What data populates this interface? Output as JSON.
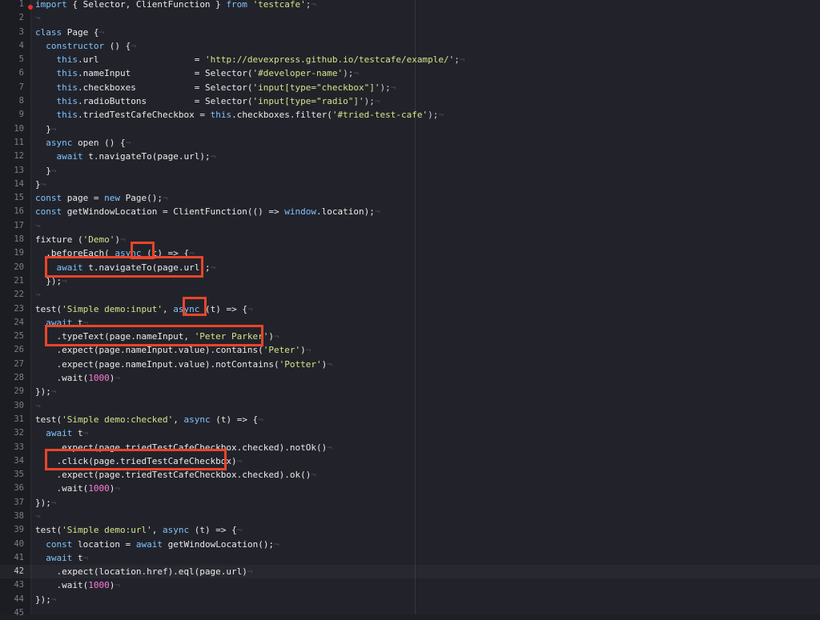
{
  "editor": {
    "current_line": 42,
    "breakpoint_line": 1,
    "lines": [
      {
        "n": "1",
        "tokens": [
          {
            "t": "import",
            "c": "kw"
          },
          {
            "t": " { Selector, ClientFunction } ",
            "c": "plain"
          },
          {
            "t": "from",
            "c": "kw"
          },
          {
            "t": " ",
            "c": "plain"
          },
          {
            "t": "'testcafe'",
            "c": "str"
          },
          {
            "t": ";",
            "c": "pn"
          },
          {
            "t": "¬",
            "c": "ws"
          }
        ]
      },
      {
        "n": "2",
        "tokens": [
          {
            "t": "¬",
            "c": "ws"
          }
        ]
      },
      {
        "n": "3",
        "tokens": [
          {
            "t": "class",
            "c": "kw"
          },
          {
            "t": " Page {",
            "c": "plain"
          },
          {
            "t": "¬",
            "c": "ws"
          }
        ]
      },
      {
        "n": "4",
        "tokens": [
          {
            "t": "  ",
            "c": "plain"
          },
          {
            "t": "constructor",
            "c": "kw"
          },
          {
            "t": " () {",
            "c": "plain"
          },
          {
            "t": "¬",
            "c": "ws"
          }
        ]
      },
      {
        "n": "5",
        "tokens": [
          {
            "t": "    ",
            "c": "plain"
          },
          {
            "t": "this",
            "c": "kw"
          },
          {
            "t": ".url                  = ",
            "c": "plain"
          },
          {
            "t": "'http://devexpress.github.io/testcafe/example/'",
            "c": "str"
          },
          {
            "t": ";",
            "c": "pn"
          },
          {
            "t": "¬",
            "c": "ws"
          }
        ]
      },
      {
        "n": "6",
        "tokens": [
          {
            "t": "    ",
            "c": "plain"
          },
          {
            "t": "this",
            "c": "kw"
          },
          {
            "t": ".nameInput            = Selector(",
            "c": "plain"
          },
          {
            "t": "'#developer-name'",
            "c": "str"
          },
          {
            "t": ");",
            "c": "pn"
          },
          {
            "t": "¬",
            "c": "ws"
          }
        ]
      },
      {
        "n": "7",
        "tokens": [
          {
            "t": "    ",
            "c": "plain"
          },
          {
            "t": "this",
            "c": "kw"
          },
          {
            "t": ".checkboxes           = Selector(",
            "c": "plain"
          },
          {
            "t": "'input[type=\"checkbox\"]'",
            "c": "str"
          },
          {
            "t": ");",
            "c": "pn"
          },
          {
            "t": "¬",
            "c": "ws"
          }
        ]
      },
      {
        "n": "8",
        "tokens": [
          {
            "t": "    ",
            "c": "plain"
          },
          {
            "t": "this",
            "c": "kw"
          },
          {
            "t": ".radioButtons         = Selector(",
            "c": "plain"
          },
          {
            "t": "'input[type=\"radio\"]'",
            "c": "str"
          },
          {
            "t": ");",
            "c": "pn"
          },
          {
            "t": "¬",
            "c": "ws"
          }
        ]
      },
      {
        "n": "9",
        "tokens": [
          {
            "t": "    ",
            "c": "plain"
          },
          {
            "t": "this",
            "c": "kw"
          },
          {
            "t": ".triedTestCafeCheckbox = ",
            "c": "plain"
          },
          {
            "t": "this",
            "c": "kw"
          },
          {
            "t": ".checkboxes.filter(",
            "c": "plain"
          },
          {
            "t": "'#tried-test-cafe'",
            "c": "str"
          },
          {
            "t": ");",
            "c": "pn"
          },
          {
            "t": "¬",
            "c": "ws"
          }
        ]
      },
      {
        "n": "10",
        "tokens": [
          {
            "t": "  }",
            "c": "plain"
          },
          {
            "t": "¬",
            "c": "ws"
          }
        ]
      },
      {
        "n": "11",
        "tokens": [
          {
            "t": "  ",
            "c": "plain"
          },
          {
            "t": "async",
            "c": "kw"
          },
          {
            "t": " open () {",
            "c": "plain"
          },
          {
            "t": "¬",
            "c": "ws"
          }
        ]
      },
      {
        "n": "12",
        "tokens": [
          {
            "t": "    ",
            "c": "plain"
          },
          {
            "t": "await",
            "c": "kw"
          },
          {
            "t": " t.navigateTo(page.url);",
            "c": "plain"
          },
          {
            "t": "¬",
            "c": "ws"
          }
        ]
      },
      {
        "n": "13",
        "tokens": [
          {
            "t": "  }",
            "c": "plain"
          },
          {
            "t": "¬",
            "c": "ws"
          }
        ]
      },
      {
        "n": "14",
        "tokens": [
          {
            "t": "}",
            "c": "plain"
          },
          {
            "t": "¬",
            "c": "ws"
          }
        ]
      },
      {
        "n": "15",
        "tokens": [
          {
            "t": "const",
            "c": "kw"
          },
          {
            "t": " page = ",
            "c": "plain"
          },
          {
            "t": "new",
            "c": "kw"
          },
          {
            "t": " Page();",
            "c": "plain"
          },
          {
            "t": "¬",
            "c": "ws"
          }
        ]
      },
      {
        "n": "16",
        "tokens": [
          {
            "t": "const",
            "c": "kw"
          },
          {
            "t": " getWindowLocation = ClientFunction(() => ",
            "c": "plain"
          },
          {
            "t": "window",
            "c": "kw"
          },
          {
            "t": ".location);",
            "c": "plain"
          },
          {
            "t": "¬",
            "c": "ws"
          }
        ]
      },
      {
        "n": "17",
        "tokens": [
          {
            "t": "¬",
            "c": "ws"
          }
        ]
      },
      {
        "n": "18",
        "tokens": [
          {
            "t": "fixture",
            "c": "plain"
          },
          {
            "t": " (",
            "c": "plain"
          },
          {
            "t": "'Demo'",
            "c": "str"
          },
          {
            "t": ")",
            "c": "plain"
          },
          {
            "t": "¬",
            "c": "ws"
          }
        ]
      },
      {
        "n": "19",
        "tokens": [
          {
            "t": "  .beforeEach( ",
            "c": "plain"
          },
          {
            "t": "async",
            "c": "kw"
          },
          {
            "t": " (t) => {",
            "c": "plain"
          },
          {
            "t": "¬",
            "c": "ws"
          }
        ]
      },
      {
        "n": "20",
        "tokens": [
          {
            "t": "    ",
            "c": "plain"
          },
          {
            "t": "await",
            "c": "kw"
          },
          {
            "t": " t.navigateTo(page.url);",
            "c": "plain"
          },
          {
            "t": "¬",
            "c": "ws"
          }
        ]
      },
      {
        "n": "21",
        "tokens": [
          {
            "t": "  });",
            "c": "plain"
          },
          {
            "t": "¬",
            "c": "ws"
          }
        ]
      },
      {
        "n": "22",
        "tokens": [
          {
            "t": "¬",
            "c": "ws"
          }
        ]
      },
      {
        "n": "23",
        "tokens": [
          {
            "t": "test(",
            "c": "plain"
          },
          {
            "t": "'Simple demo:input'",
            "c": "str"
          },
          {
            "t": ", ",
            "c": "plain"
          },
          {
            "t": "async",
            "c": "kw"
          },
          {
            "t": " (t) => {",
            "c": "plain"
          },
          {
            "t": "¬",
            "c": "ws"
          }
        ]
      },
      {
        "n": "24",
        "tokens": [
          {
            "t": "  ",
            "c": "plain"
          },
          {
            "t": "await",
            "c": "kw"
          },
          {
            "t": " t",
            "c": "plain"
          },
          {
            "t": "¬",
            "c": "ws"
          }
        ]
      },
      {
        "n": "25",
        "tokens": [
          {
            "t": "    .typeText(page.nameInput, ",
            "c": "plain"
          },
          {
            "t": "'Peter Parker'",
            "c": "str"
          },
          {
            "t": ")",
            "c": "plain"
          },
          {
            "t": "¬",
            "c": "ws"
          }
        ]
      },
      {
        "n": "26",
        "tokens": [
          {
            "t": "    .expect(page.nameInput.value).contains(",
            "c": "plain"
          },
          {
            "t": "'Peter'",
            "c": "str"
          },
          {
            "t": ")",
            "c": "plain"
          },
          {
            "t": "¬",
            "c": "ws"
          }
        ]
      },
      {
        "n": "27",
        "tokens": [
          {
            "t": "    .expect(page.nameInput.value).notContains(",
            "c": "plain"
          },
          {
            "t": "'Potter'",
            "c": "str"
          },
          {
            "t": ")",
            "c": "plain"
          },
          {
            "t": "¬",
            "c": "ws"
          }
        ]
      },
      {
        "n": "28",
        "tokens": [
          {
            "t": "    .wait(",
            "c": "plain"
          },
          {
            "t": "1000",
            "c": "num"
          },
          {
            "t": ")",
            "c": "plain"
          },
          {
            "t": "¬",
            "c": "ws"
          }
        ]
      },
      {
        "n": "29",
        "tokens": [
          {
            "t": "});",
            "c": "plain"
          },
          {
            "t": "¬",
            "c": "ws"
          }
        ]
      },
      {
        "n": "30",
        "tokens": [
          {
            "t": "¬",
            "c": "ws"
          }
        ]
      },
      {
        "n": "31",
        "tokens": [
          {
            "t": "test(",
            "c": "plain"
          },
          {
            "t": "'Simple demo:checked'",
            "c": "str"
          },
          {
            "t": ", ",
            "c": "plain"
          },
          {
            "t": "async",
            "c": "kw"
          },
          {
            "t": " (t) => {",
            "c": "plain"
          },
          {
            "t": "¬",
            "c": "ws"
          }
        ]
      },
      {
        "n": "32",
        "tokens": [
          {
            "t": "  ",
            "c": "plain"
          },
          {
            "t": "await",
            "c": "kw"
          },
          {
            "t": " t",
            "c": "plain"
          },
          {
            "t": "¬",
            "c": "ws"
          }
        ]
      },
      {
        "n": "33",
        "tokens": [
          {
            "t": "    .expect(page.triedTestCafeCheckbox.checked).notOk()",
            "c": "plain"
          },
          {
            "t": "¬",
            "c": "ws"
          }
        ]
      },
      {
        "n": "34",
        "tokens": [
          {
            "t": "    .click(page.triedTestCafeCheckbox)",
            "c": "plain"
          },
          {
            "t": "¬",
            "c": "ws"
          }
        ]
      },
      {
        "n": "35",
        "tokens": [
          {
            "t": "    .expect(page.triedTestCafeCheckbox.checked).ok()",
            "c": "plain"
          },
          {
            "t": "¬",
            "c": "ws"
          }
        ]
      },
      {
        "n": "36",
        "tokens": [
          {
            "t": "    .wait(",
            "c": "plain"
          },
          {
            "t": "1000",
            "c": "num"
          },
          {
            "t": ")",
            "c": "plain"
          },
          {
            "t": "¬",
            "c": "ws"
          }
        ]
      },
      {
        "n": "37",
        "tokens": [
          {
            "t": "});",
            "c": "plain"
          },
          {
            "t": "¬",
            "c": "ws"
          }
        ]
      },
      {
        "n": "38",
        "tokens": [
          {
            "t": "¬",
            "c": "ws"
          }
        ]
      },
      {
        "n": "39",
        "tokens": [
          {
            "t": "test(",
            "c": "plain"
          },
          {
            "t": "'Simple demo:url'",
            "c": "str"
          },
          {
            "t": ", ",
            "c": "plain"
          },
          {
            "t": "async",
            "c": "kw"
          },
          {
            "t": " (t) => {",
            "c": "plain"
          },
          {
            "t": "¬",
            "c": "ws"
          }
        ]
      },
      {
        "n": "40",
        "tokens": [
          {
            "t": "  ",
            "c": "plain"
          },
          {
            "t": "const",
            "c": "kw"
          },
          {
            "t": " location = ",
            "c": "plain"
          },
          {
            "t": "await",
            "c": "kw"
          },
          {
            "t": " getWindowLocation();",
            "c": "plain"
          },
          {
            "t": "¬",
            "c": "ws"
          }
        ]
      },
      {
        "n": "41",
        "tokens": [
          {
            "t": "  ",
            "c": "plain"
          },
          {
            "t": "await",
            "c": "kw"
          },
          {
            "t": " t",
            "c": "plain"
          },
          {
            "t": "¬",
            "c": "ws"
          }
        ]
      },
      {
        "n": "42",
        "tokens": [
          {
            "t": "    .expect(location.href).eql(page.url)",
            "c": "plain"
          },
          {
            "t": "¬",
            "c": "ws"
          }
        ]
      },
      {
        "n": "43",
        "tokens": [
          {
            "t": "    .wait(",
            "c": "plain"
          },
          {
            "t": "1000",
            "c": "num"
          },
          {
            "t": ")",
            "c": "plain"
          },
          {
            "t": "¬",
            "c": "ws"
          }
        ]
      },
      {
        "n": "44",
        "tokens": [
          {
            "t": "});",
            "c": "plain"
          },
          {
            "t": "¬",
            "c": "ws"
          }
        ]
      },
      {
        "n": "45",
        "tokens": []
      }
    ]
  },
  "colors": {
    "keyword": "#7fc3ff",
    "string": "#cfe787",
    "number": "#ff7ad9",
    "highlight_box": "#e8452a",
    "breakpoint": "#e3322c",
    "background": "#22232a"
  },
  "annotations": [
    {
      "label": "highlight-box",
      "line": 19,
      "text": "(t)"
    },
    {
      "label": "highlight-box",
      "line": 20,
      "text": "await t.navigateTo(page.url);"
    },
    {
      "label": "highlight-box",
      "line": 23,
      "text": "(t)"
    },
    {
      "label": "highlight-box",
      "line": 25,
      "text": ".typeText(page.nameInput, 'Peter Parker')"
    },
    {
      "label": "highlight-box",
      "line": 34,
      "text": ".click(page.triedTestCafeCheckbox)"
    }
  ]
}
